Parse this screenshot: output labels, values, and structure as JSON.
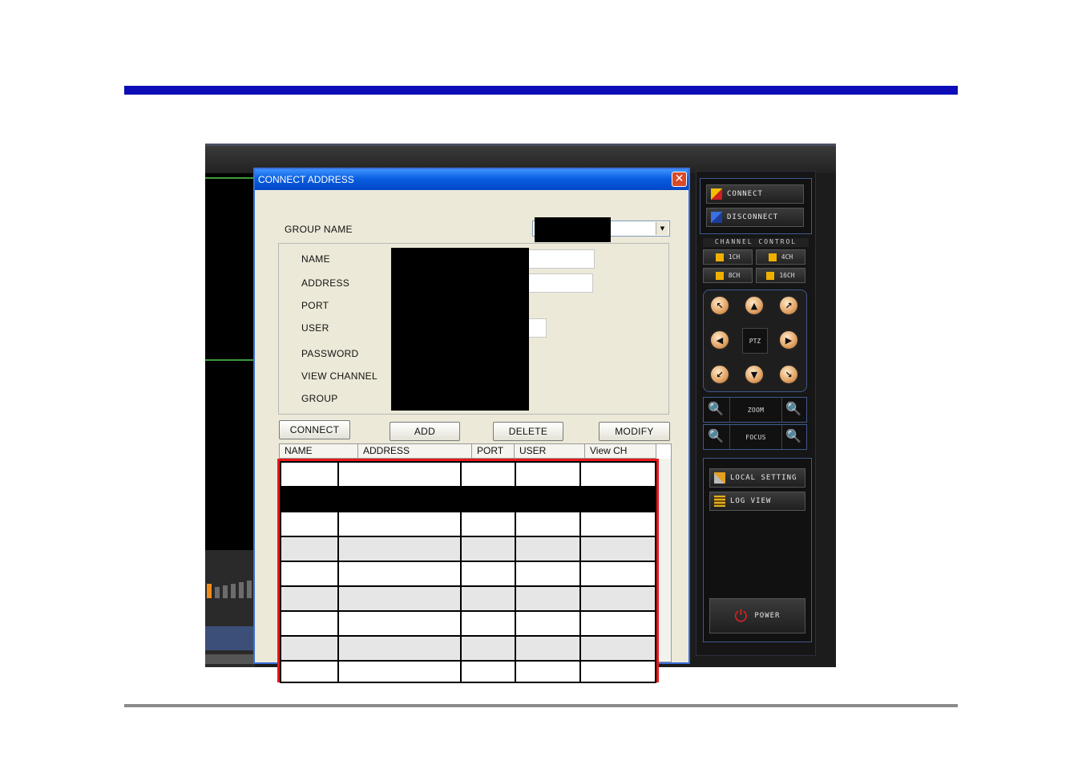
{
  "dialog": {
    "title": "CONNECT ADDRESS",
    "close_icon": "close-icon",
    "group_name_label": "GROUP  NAME",
    "fields": {
      "name": "NAME",
      "address": "ADDRESS",
      "port": "PORT",
      "user": "USER",
      "password": "PASSWORD",
      "view_channel": "VIEW CHANNEL",
      "group": "GROUP"
    },
    "buttons": {
      "connect": "CONNECT",
      "add": "ADD",
      "delete": "DELETE",
      "modify": "MODIFY"
    },
    "list_columns": [
      "NAME",
      "ADDRESS",
      "PORT",
      "USER",
      "View CH"
    ]
  },
  "panel": {
    "connect": "CONNECT",
    "disconnect": "DISCONNECT",
    "channel_control": "CHANNEL CONTROL",
    "channels": [
      "1CH",
      "4CH",
      "8CH",
      "16CH"
    ],
    "ptz": "PTZ",
    "zoom": "ZOOM",
    "focus": "FOCUS",
    "local_setting": "LOCAL SETTING",
    "log_view": "LOG VIEW",
    "power": "POWER"
  },
  "colors": {
    "title_band": "#0d0db8",
    "highlight_border": "#e81818",
    "ptz_button": "#e0a060",
    "channel_icon": "#f0b000"
  }
}
